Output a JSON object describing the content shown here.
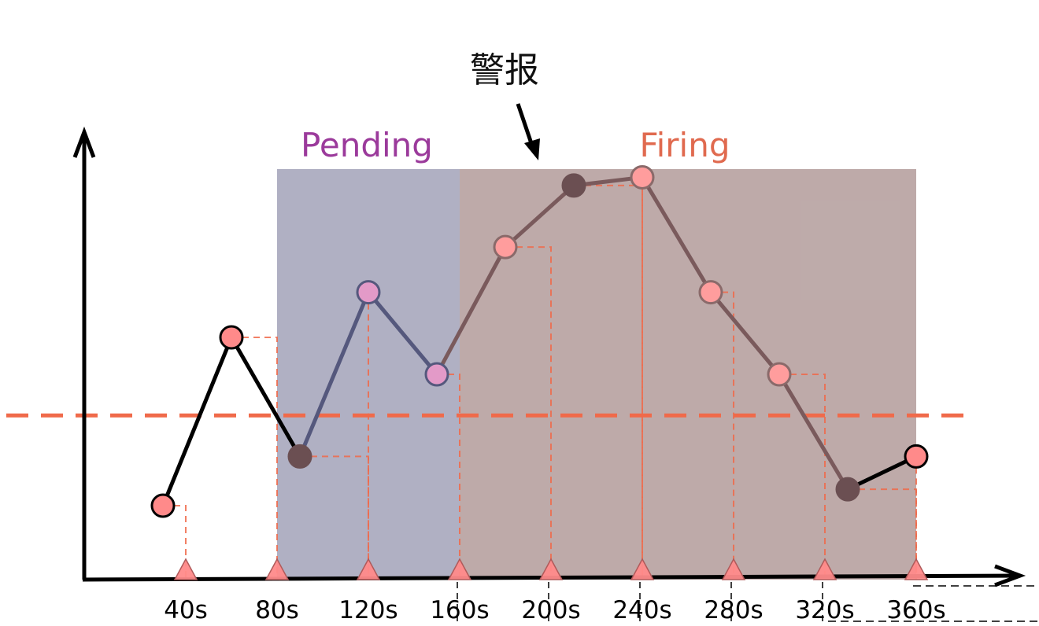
{
  "annotation": {
    "text": "警报"
  },
  "regions": {
    "pending": {
      "label": "Pending",
      "label_color": "#9b3a9b",
      "fill": "#4f507a"
    },
    "firing": {
      "label": "Firing",
      "label_color": "#e06a4f",
      "fill": "#7d5654"
    }
  },
  "colors": {
    "threshold": "#f06a4a",
    "line": "#000000",
    "point_fill": "#ff8a8a",
    "sample_marker": "#ff8a8a",
    "dark_point": "#6b4f52"
  },
  "chart_data": {
    "type": "line",
    "x_tick_labels": [
      "40s",
      "80s",
      "120s",
      "160s",
      "200s",
      "240s",
      "280s",
      "320s",
      "360s"
    ],
    "threshold_level": 0.4,
    "pending_interval": [
      80,
      160
    ],
    "firing_interval": [
      160,
      360
    ],
    "series": [
      {
        "values": [
          {
            "t": 30,
            "v": 0.18
          },
          {
            "t": 60,
            "v": 0.59
          },
          {
            "t": 90,
            "v": 0.3
          },
          {
            "t": 120,
            "v": 0.7
          },
          {
            "t": 150,
            "v": 0.5
          },
          {
            "t": 180,
            "v": 0.81
          },
          {
            "t": 210,
            "v": 0.96
          },
          {
            "t": 240,
            "v": 0.98
          },
          {
            "t": 270,
            "v": 0.7
          },
          {
            "t": 300,
            "v": 0.5
          },
          {
            "t": 330,
            "v": 0.22
          },
          {
            "t": 360,
            "v": 0.3
          }
        ]
      }
    ],
    "sample_times": [
      40,
      80,
      120,
      160,
      200,
      240,
      280,
      320,
      360
    ]
  }
}
